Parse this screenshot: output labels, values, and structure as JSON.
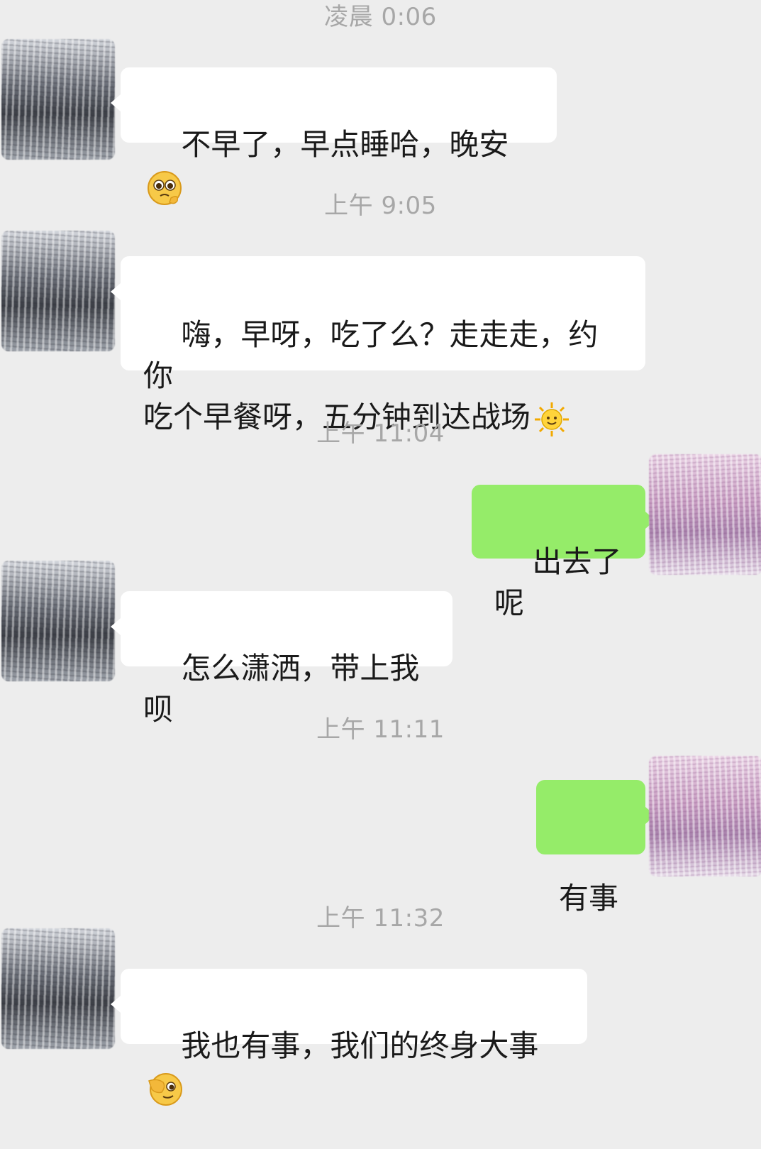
{
  "chat": {
    "messages": [
      {
        "time": "凌晨 0:06",
        "sender": "contact",
        "text": "不早了，早点睡哈，晚安",
        "emoji": "pleading-face-icon"
      },
      {
        "time": "上午 9:05",
        "sender": "contact",
        "text": "嗨，早呀，吃了么？走走走，约你\n吃个早餐呀，五分钟到达战场",
        "emoji": "sun-with-face-icon"
      },
      {
        "time": "上午 11:04",
        "sender": "me",
        "text": "出去了呢"
      },
      {
        "sender": "contact",
        "text": "怎么潇洒，带上我呗"
      },
      {
        "time": "上午 11:11",
        "sender": "me",
        "text": "有事"
      },
      {
        "time": "上午 11:32",
        "sender": "contact",
        "text": "我也有事，我们的终身大事",
        "emoji": "face-with-hand-over-eye-icon"
      }
    ]
  },
  "colors": {
    "background": "#ededed",
    "incoming_bubble": "#ffffff",
    "outgoing_bubble": "#95ec69",
    "timestamp_text": "#a7a7a7"
  }
}
